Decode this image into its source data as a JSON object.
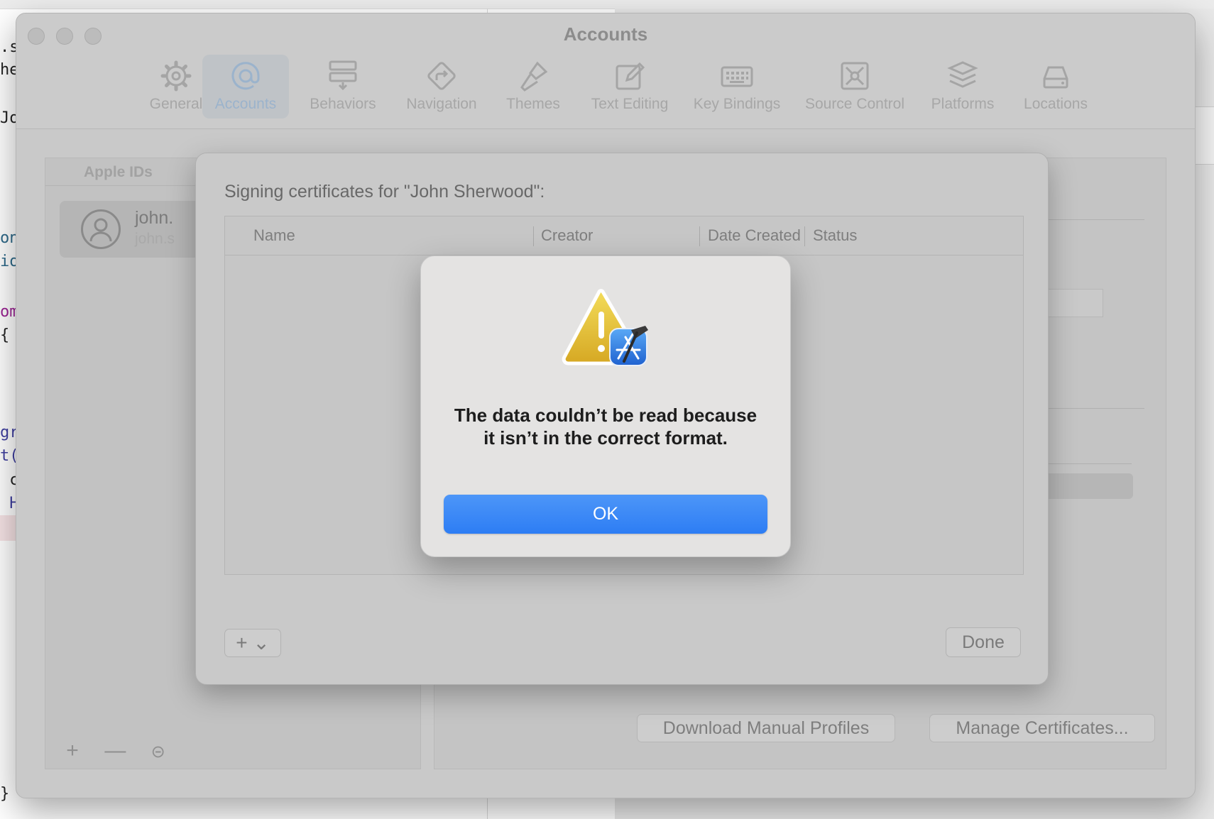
{
  "background": {
    "code_lines": [
      ".s",
      "he",
      "Jo",
      "on",
      "io",
      "om",
      "{",
      "gr",
      "t(",
      " c",
      " H",
      "}"
    ]
  },
  "window": {
    "title": "Accounts"
  },
  "toolbar": {
    "items": [
      {
        "label": "General",
        "icon": "gear-icon"
      },
      {
        "label": "Accounts",
        "icon": "at-sign-icon",
        "active": true
      },
      {
        "label": "Behaviors",
        "icon": "behaviors-icon"
      },
      {
        "label": "Navigation",
        "icon": "navigation-arrow-icon"
      },
      {
        "label": "Themes",
        "icon": "brush-icon"
      },
      {
        "label": "Text Editing",
        "icon": "pencil-square-icon"
      },
      {
        "label": "Key Bindings",
        "icon": "keyboard-icon"
      },
      {
        "label": "Source Control",
        "icon": "source-control-icon"
      },
      {
        "label": "Platforms",
        "icon": "layers-icon"
      },
      {
        "label": "Locations",
        "icon": "drive-icon"
      }
    ]
  },
  "accounts_panel": {
    "header": "Apple IDs",
    "account": {
      "name": "john.",
      "sub": "john.s"
    },
    "footer_buttons": [
      "+",
      "—",
      "⊝"
    ]
  },
  "detail_panel": {
    "download_button": "Download Manual Profiles",
    "manage_button": "Manage Certificates..."
  },
  "sheet": {
    "title": "Signing certificates for \"John Sherwood\":",
    "columns": [
      "Name",
      "Creator",
      "Date Created",
      "Status"
    ],
    "add_button": "+ ⌄",
    "done_button": "Done"
  },
  "alert": {
    "message": "The data couldn’t be read because it isn’t in the correct format.",
    "ok_button": "OK",
    "accent": "#2d7df4"
  }
}
